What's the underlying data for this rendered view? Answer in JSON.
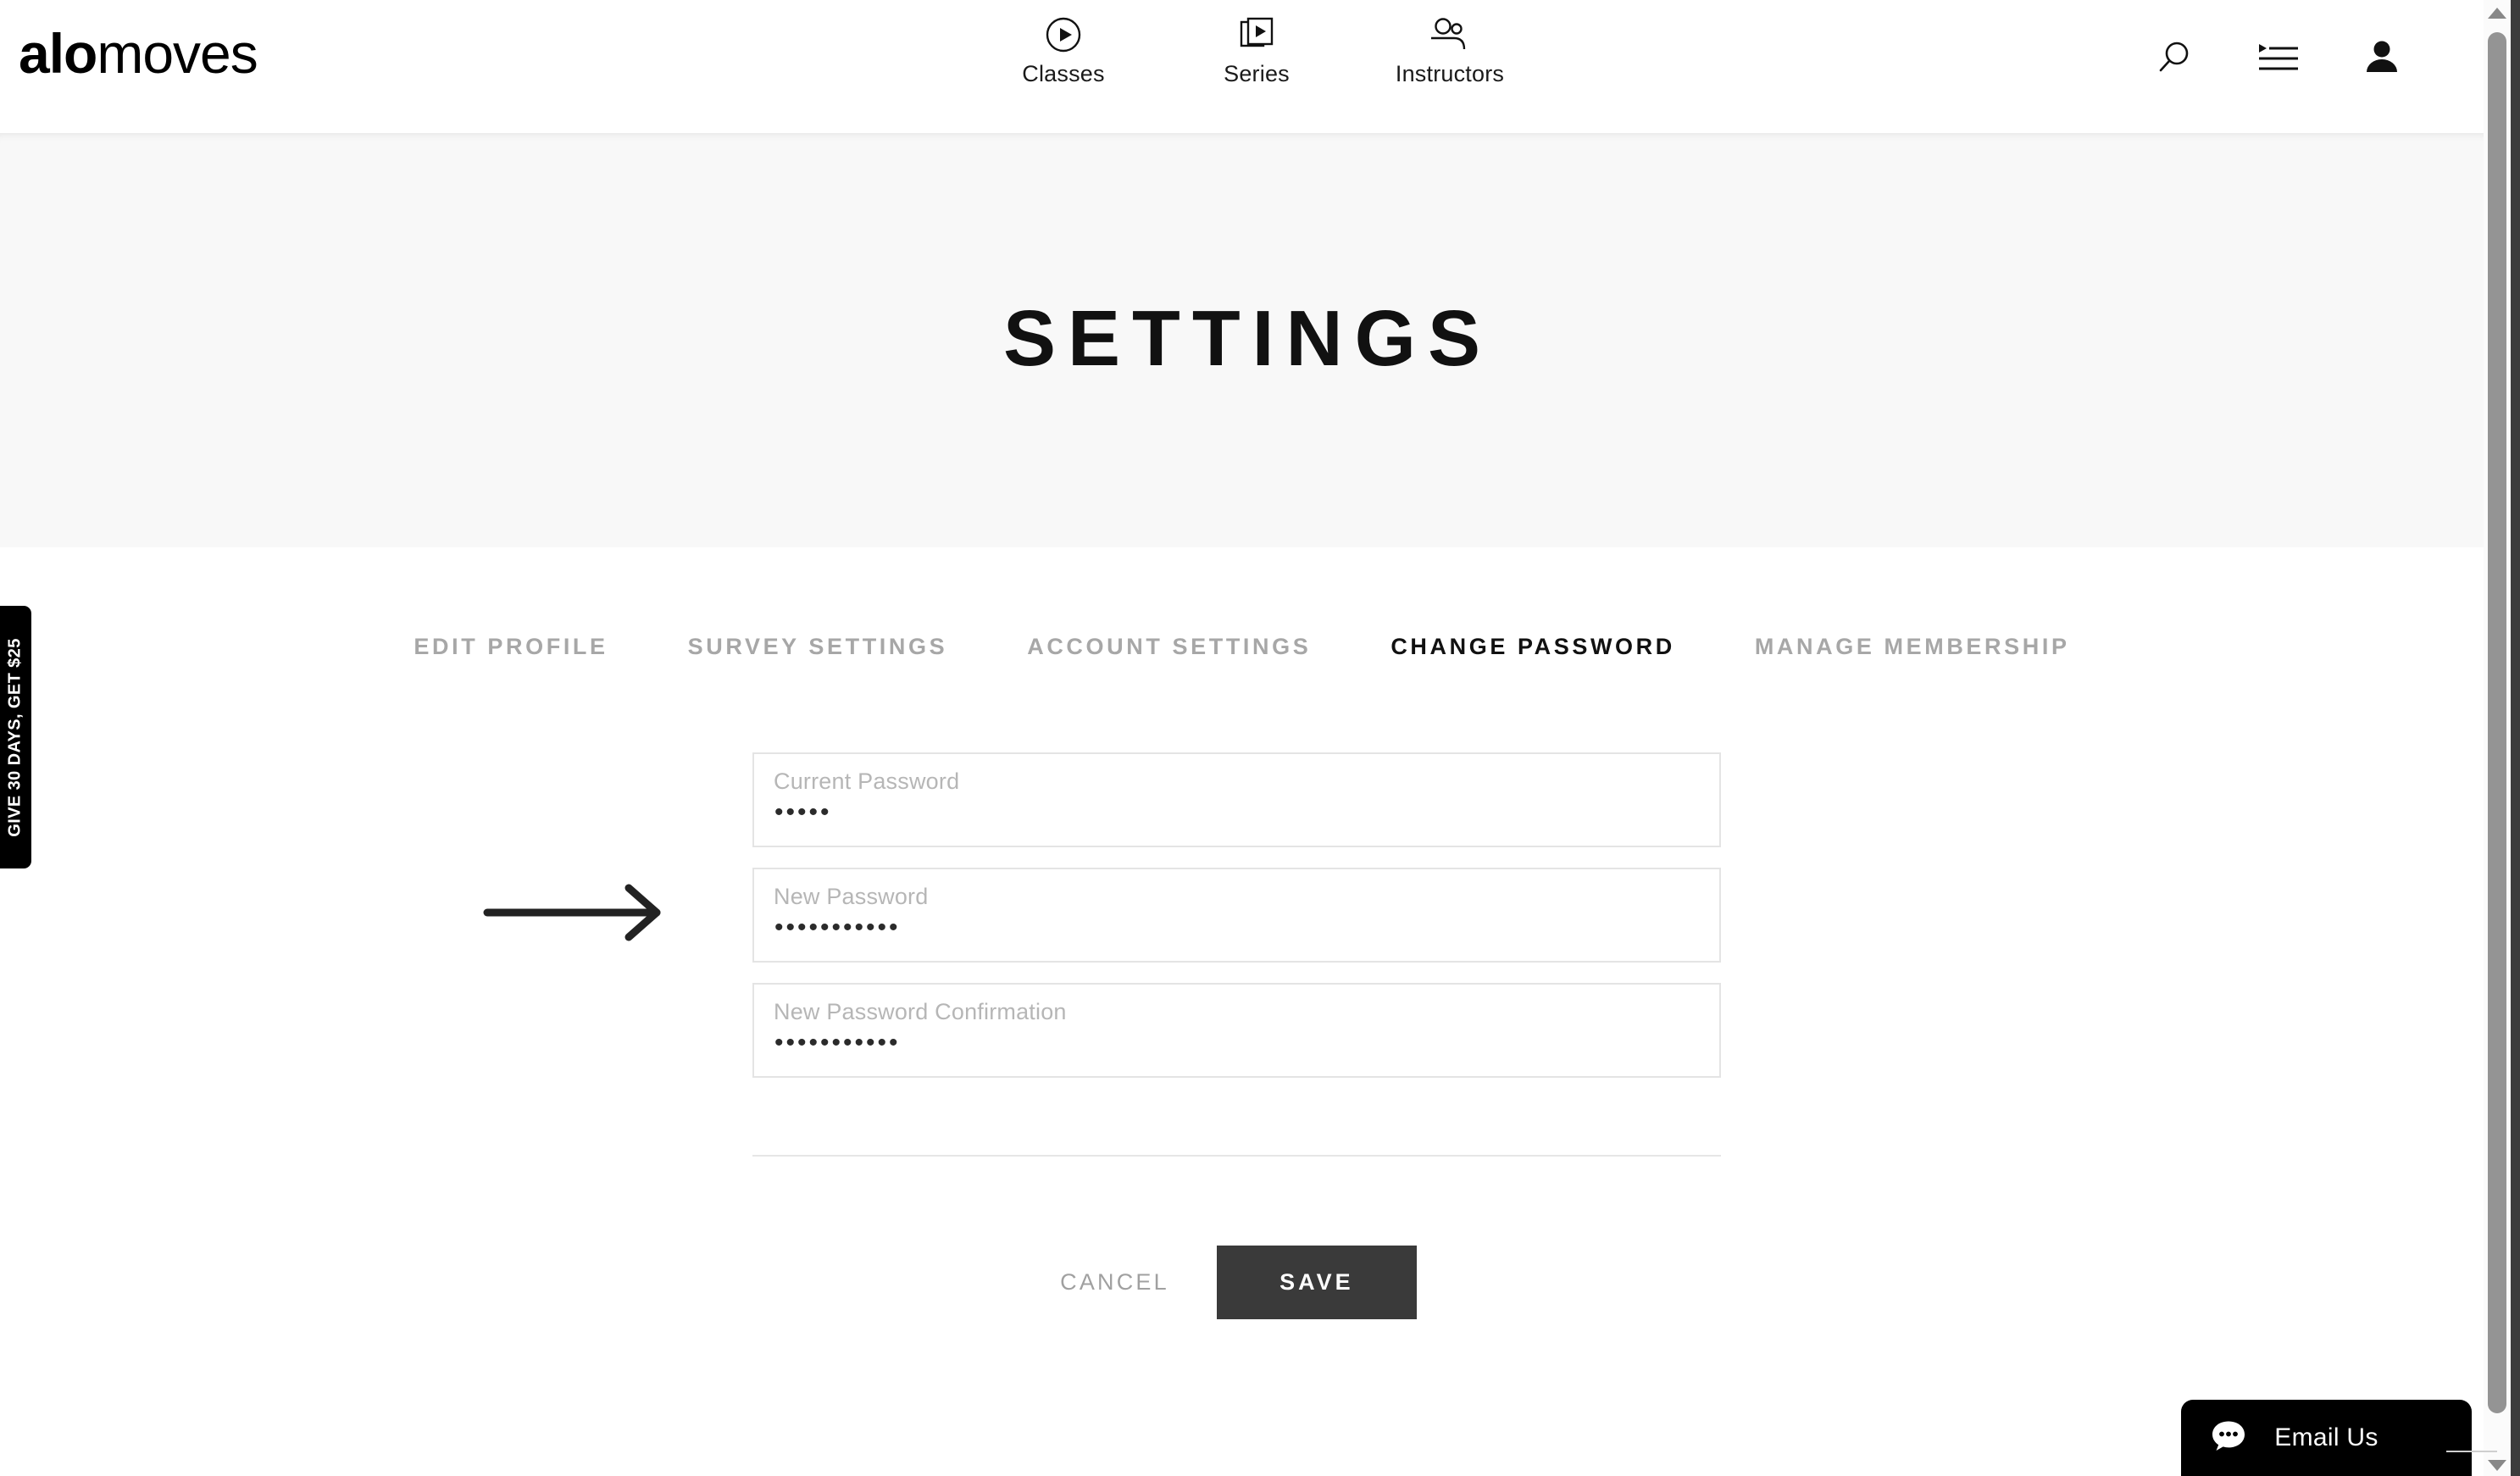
{
  "brand": {
    "logo_bold": "alo",
    "logo_light": "moves"
  },
  "header": {
    "nav": [
      {
        "label": "Classes",
        "icon": "play-circle-icon"
      },
      {
        "label": "Series",
        "icon": "video-stack-icon"
      },
      {
        "label": "Instructors",
        "icon": "people-icon"
      }
    ],
    "actions": [
      {
        "name": "search-icon",
        "label": "Search"
      },
      {
        "name": "playlist-icon",
        "label": "My List"
      },
      {
        "name": "account-icon",
        "label": "Account"
      }
    ]
  },
  "hero": {
    "title": "SETTINGS"
  },
  "tabs": [
    {
      "label": "EDIT PROFILE",
      "active": false
    },
    {
      "label": "SURVEY SETTINGS",
      "active": false
    },
    {
      "label": "ACCOUNT SETTINGS",
      "active": false
    },
    {
      "label": "CHANGE PASSWORD",
      "active": true
    },
    {
      "label": "MANAGE MEMBERSHIP",
      "active": false
    }
  ],
  "form": {
    "fields": [
      {
        "label": "Current Password",
        "placeholder": "Current Password",
        "value": "•••••",
        "char_count": 5
      },
      {
        "label": "New Password",
        "placeholder": "New Password",
        "value": "•••••••••••",
        "char_count": 11
      },
      {
        "label": "New Password Confirmation",
        "placeholder": "New Password Confirmation",
        "value": "•••••••••••",
        "char_count": 11
      }
    ]
  },
  "actions": {
    "cancel_label": "CANCEL",
    "save_label": "SAVE",
    "save_bg": "#3a3a3a"
  },
  "promo": {
    "text": "GIVE 30 DAYS, GET $25"
  },
  "chat": {
    "label": "Email Us",
    "icon": "chat-bubble-icon"
  },
  "colors": {
    "hero_bg": "#f8f8f8",
    "tab_inactive": "#a7a7a7",
    "tab_active": "#111111",
    "field_border": "#e4e4e4",
    "placeholder": "#b6b6b6"
  }
}
